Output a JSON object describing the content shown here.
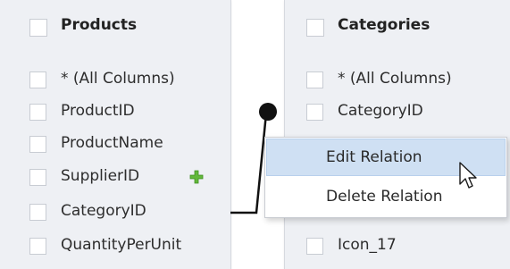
{
  "products_table": {
    "title": "Products",
    "columns": [
      "* (All Columns)",
      "ProductID",
      "ProductName",
      "SupplierID",
      "CategoryID",
      "QuantityPerUnit"
    ]
  },
  "categories_table": {
    "title": "Categories",
    "columns": [
      "* (All Columns)",
      "CategoryID",
      "",
      "",
      "",
      "Icon_17"
    ]
  },
  "context_menu": {
    "items": [
      "Edit Relation",
      "Delete Relation"
    ]
  },
  "icons": {
    "add": "plus-icon",
    "cursor": "arrow-pointer-icon"
  },
  "colors": {
    "table_bg": "#eef0f4",
    "highlight": "#cfe0f3",
    "add_icon": "#5fb336"
  }
}
